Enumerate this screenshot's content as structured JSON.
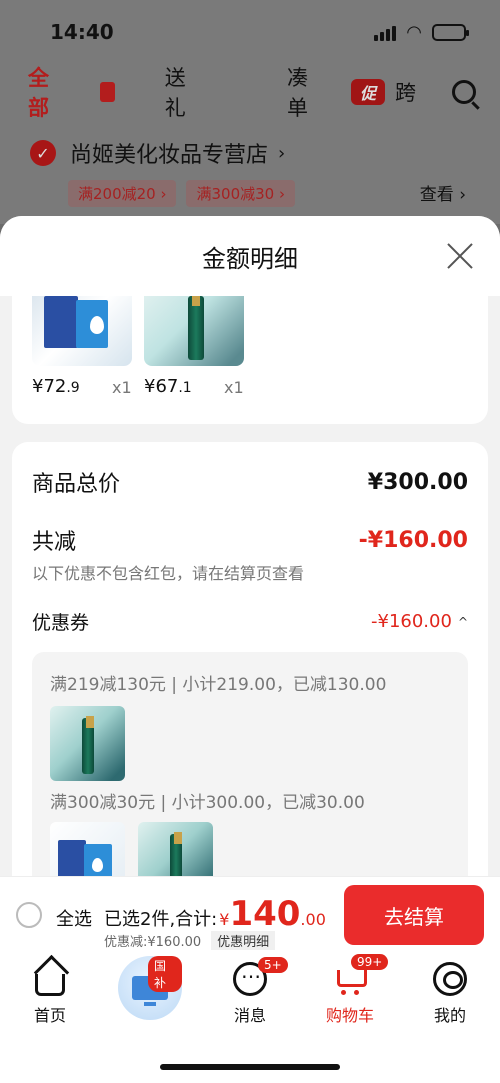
{
  "status_bar": {
    "time": "14:40"
  },
  "background_page": {
    "nav": {
      "all": "全部",
      "gift": "送礼",
      "bundle": "凑单",
      "promo_badge": "促",
      "promo": "跨"
    },
    "shop_name": "尚姬美化妆品专营店",
    "shop_chevron": "›",
    "coupon_tags": [
      "满200减20 ›",
      "满300减30 ›"
    ],
    "view": "查看 ›"
  },
  "sheet": {
    "title": "金额明细",
    "products": [
      {
        "price_int": "¥72",
        "price_dec": ".9",
        "qty": "x1"
      },
      {
        "price_int": "¥67",
        "price_dec": ".1",
        "qty": "x1"
      }
    ],
    "total_label": "商品总价",
    "total_value": "¥300.00",
    "reduce_label": "共减",
    "reduce_value": "-¥160.00",
    "reduce_note": "以下优惠不包含红包，请在结算页查看",
    "coupon_label": "优惠券",
    "coupon_value": "-¥160.00",
    "coupon_caret": "^",
    "coupon_lines": [
      "满219减130元 | 小计219.00，已减130.00",
      "满300减30元 | 小计300.00，已减30.00"
    ]
  },
  "checkout": {
    "select_all": "全选",
    "selected_text": "已选2件,合计:",
    "currency": "¥",
    "total_int": "140",
    "total_dec": ".00",
    "discount_text": "优惠减:¥160.00",
    "detail_button": "优惠明细",
    "pay_button": "去结算"
  },
  "tabbar": {
    "home": "首页",
    "gov_badge": "国补",
    "messages": "消息",
    "messages_badge": "5+",
    "cart": "购物车",
    "cart_badge": "99+",
    "me": "我的"
  }
}
